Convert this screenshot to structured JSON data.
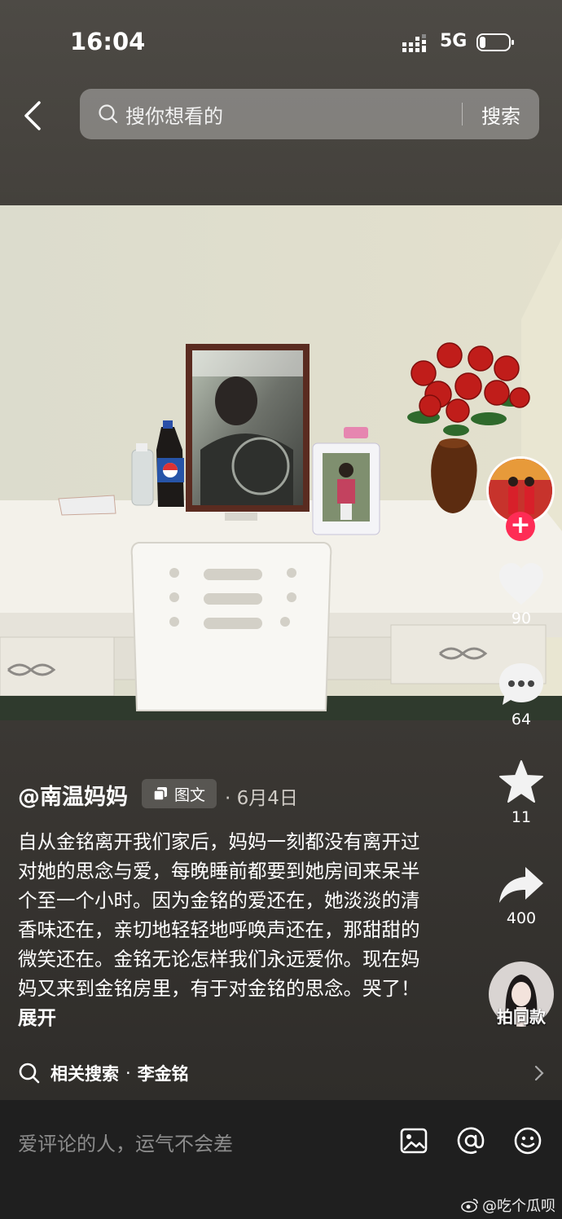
{
  "status_bar": {
    "time": "16:04",
    "network": "5G"
  },
  "header": {
    "search_placeholder": "搜你想看的",
    "search_button": "搜索"
  },
  "actions": {
    "likes": "90",
    "comments": "64",
    "favorites": "11",
    "shares": "400",
    "remix_label": "拍同款"
  },
  "post": {
    "author": "@南温妈妈",
    "type_badge": "图文",
    "date": "· 6月4日",
    "caption": "自从金铭离开我们家后，妈妈一刻都没有离开过对她的思念与爱，每晚睡前都要到她房间来呆半个至一个小时。因为金铭的爱还在，她淡淡的清香味还在，亲切地轻轻地呼唤声还在，那甜甜的微笑还在。金铭无论怎样我们永远爱你。现在妈妈又来到金铭房里，有于对金铭的思念。哭了！",
    "expand_label": "展开"
  },
  "related_search": {
    "label": "相关搜索",
    "separator": "·",
    "term": "李金铭"
  },
  "comment_bar": {
    "placeholder": "爱评论的人，运气不会差"
  },
  "watermark": "@吃个瓜呗",
  "colors": {
    "accent": "#fe2c55",
    "comment_bar": "#1f1f1f"
  },
  "icons": [
    "back-icon",
    "search-icon",
    "heart-icon",
    "comment-icon",
    "star-icon",
    "share-icon",
    "image-icon",
    "at-icon",
    "emoji-icon",
    "chevron-right-icon"
  ]
}
